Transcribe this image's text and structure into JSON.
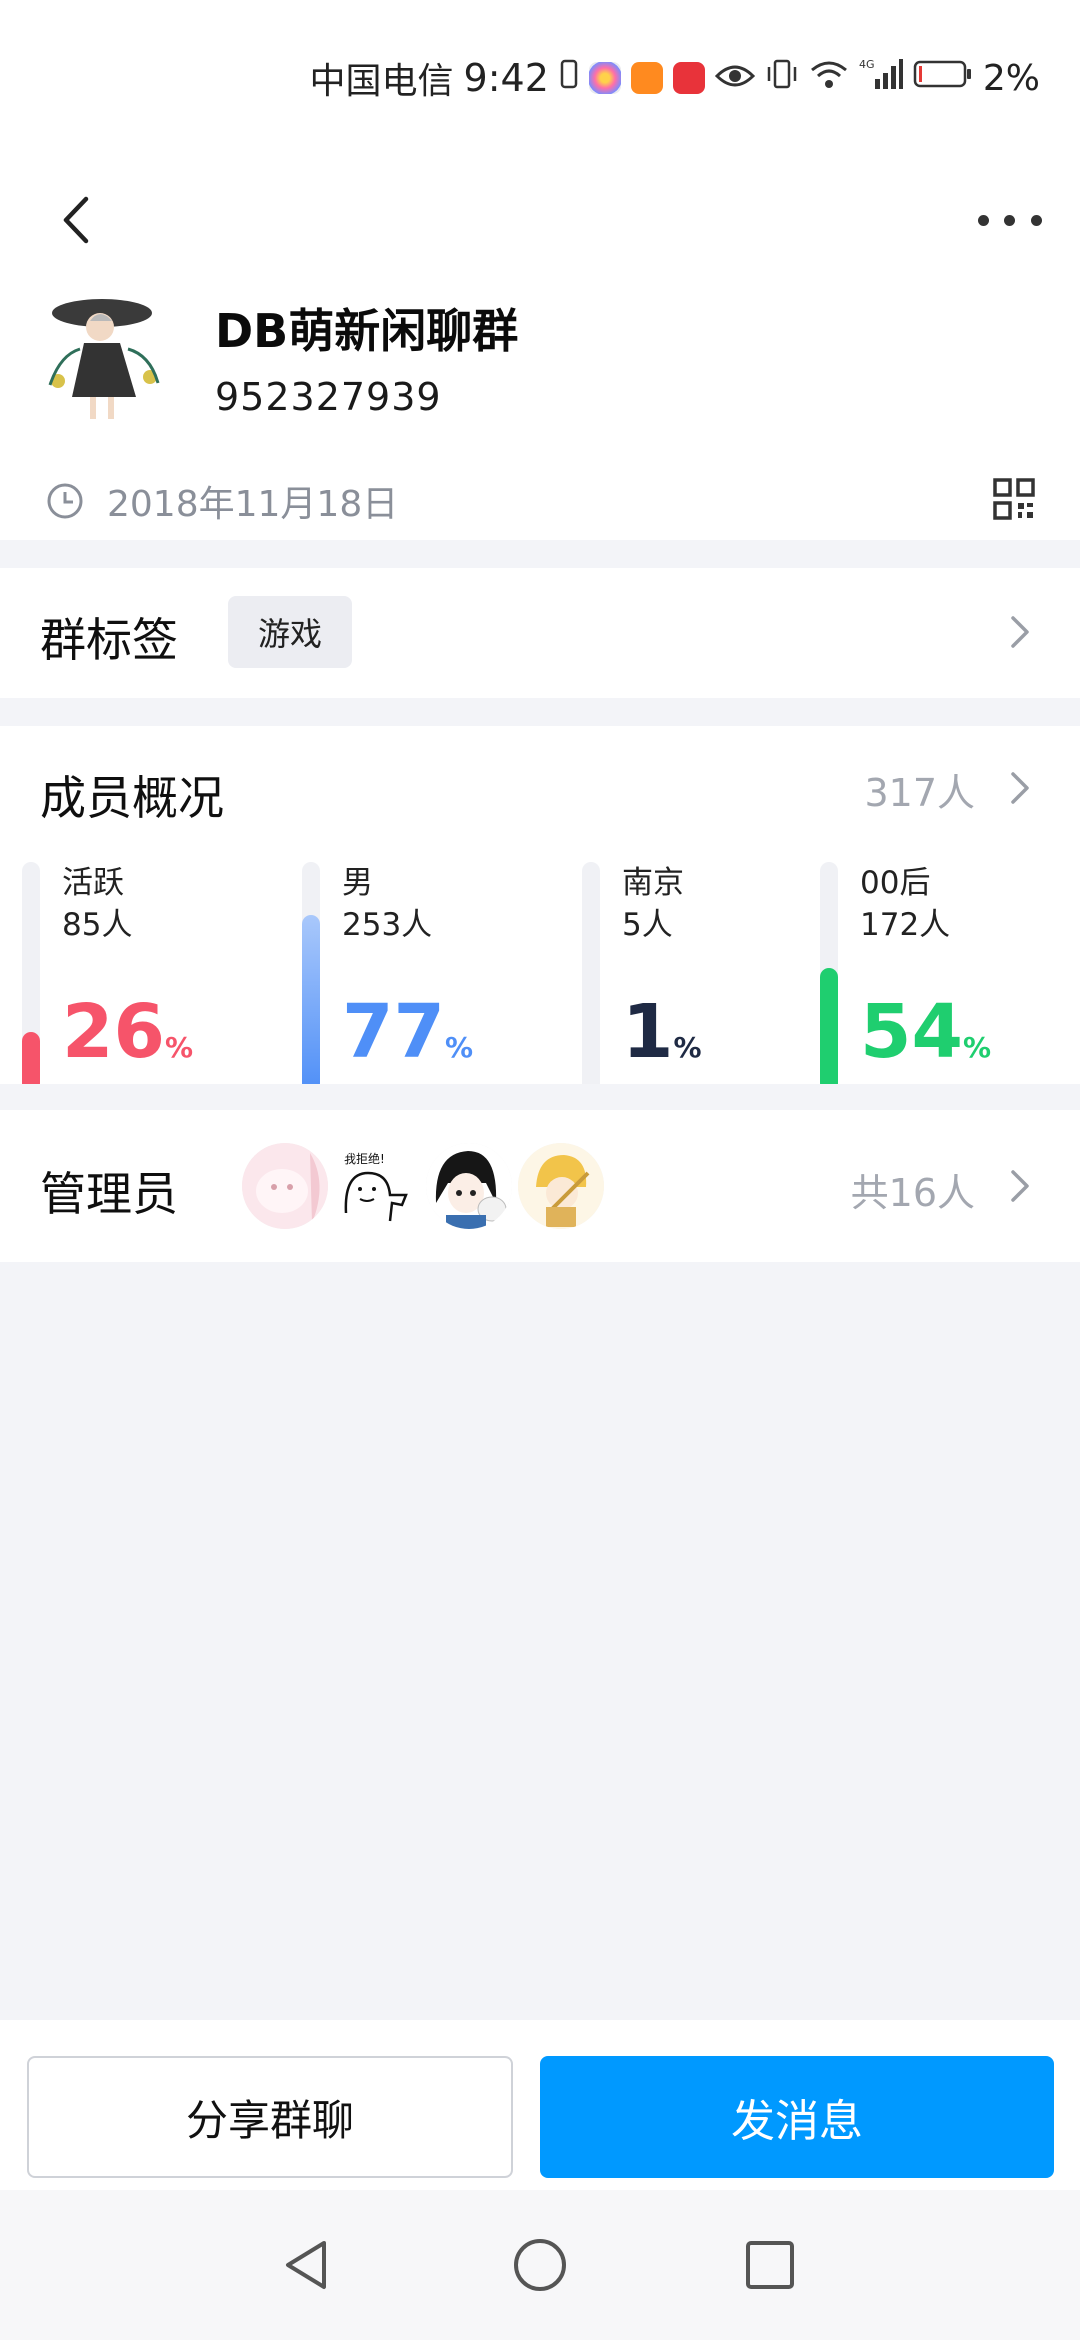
{
  "status_bar": {
    "carrier": "中国电信",
    "time": "9:42",
    "battery": "2%",
    "network": "4G"
  },
  "header": {
    "group_name": "DB萌新闲聊群",
    "group_id": "952327939",
    "created_date": "2018年11月18日"
  },
  "tags": {
    "title": "群标签",
    "chip": "游戏"
  },
  "members": {
    "title": "成员概况",
    "total": "317人",
    "stats": [
      {
        "label": "活跃",
        "count": "85人",
        "percent": "26",
        "unit": "%",
        "fill": 0.26,
        "color": "#f6546a"
      },
      {
        "label": "男",
        "count": "253人",
        "percent": "77",
        "unit": "%",
        "fill": 0.77,
        "color": "#4f8ff7"
      },
      {
        "label": "南京",
        "count": "5人",
        "percent": "1",
        "unit": "%",
        "fill": 0.01,
        "color": "#1f2a44"
      },
      {
        "label": "00后",
        "count": "172人",
        "percent": "54",
        "unit": "%",
        "fill": 0.54,
        "color": "#1fce6f"
      }
    ]
  },
  "admins": {
    "title": "管理员",
    "total": "共16人",
    "sticker_text": "我拒绝!"
  },
  "actions": {
    "share": "分享群聊",
    "send": "发消息"
  },
  "colors": {
    "accent": "#0099ff",
    "background": "#f3f4f8"
  }
}
